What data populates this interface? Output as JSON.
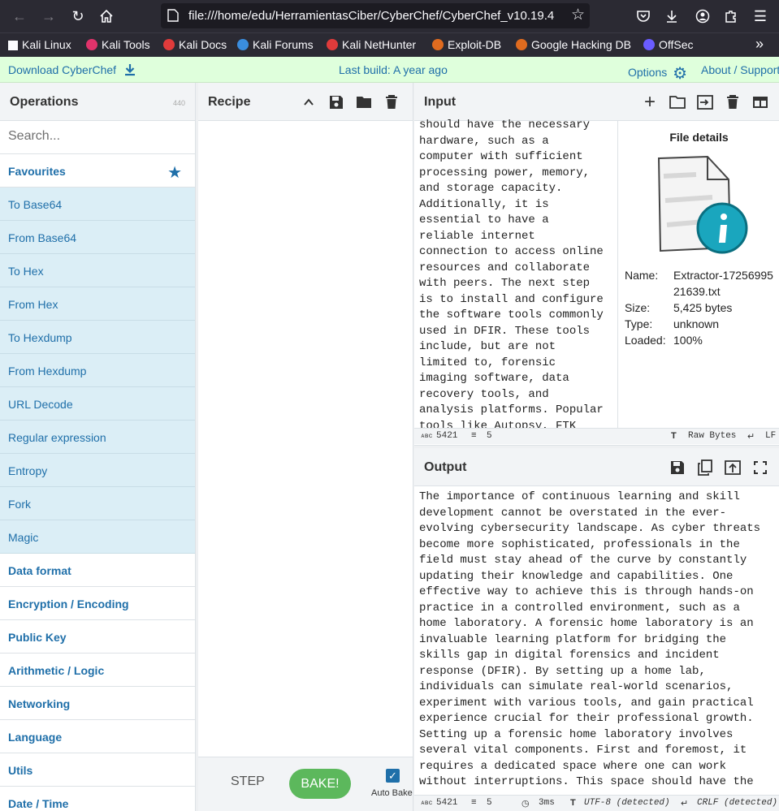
{
  "browser": {
    "url": "file:///home/edu/HerramientasCiber/CyberChef/CyberChef_v10.19.4",
    "bookmarks": [
      {
        "label": "Kali Linux",
        "color": "#3a8dde"
      },
      {
        "label": "Kali Tools",
        "color": "#e0336b"
      },
      {
        "label": "Kali Docs",
        "color": "#e03b3b"
      },
      {
        "label": "Kali Forums",
        "color": "#3a8dde"
      },
      {
        "label": "Kali NetHunter",
        "color": "#e03b3b"
      },
      {
        "label": "Exploit-DB",
        "color": "#e06b1f"
      },
      {
        "label": "Google Hacking DB",
        "color": "#e06b1f"
      },
      {
        "label": "OffSec",
        "color": "#6a5cff"
      }
    ]
  },
  "banner": {
    "download": "Download CyberChef",
    "last_build": "Last build: A year ago",
    "options": "Options",
    "about": "About / Support"
  },
  "operations": {
    "title": "Operations",
    "count": "440",
    "search_placeholder": "Search...",
    "favourites_label": "Favourites",
    "favourites": [
      "To Base64",
      "From Base64",
      "To Hex",
      "From Hex",
      "To Hexdump",
      "From Hexdump",
      "URL Decode",
      "Regular expression",
      "Entropy",
      "Fork",
      "Magic"
    ],
    "categories": [
      "Data format",
      "Encryption / Encoding",
      "Public Key",
      "Arithmetic / Logic",
      "Networking",
      "Language",
      "Utils",
      "Date / Time"
    ]
  },
  "recipe": {
    "title": "Recipe",
    "step": "STEP",
    "bake": "BAKE!",
    "auto_bake": "Auto Bake"
  },
  "input": {
    "title": "Input",
    "text": "should have the necessary\nhardware, such as a\ncomputer with sufficient\nprocessing power, memory,\nand storage capacity.\nAdditionally, it is\nessential to have a\nreliable internet\nconnection to access online\nresources and collaborate\nwith peers. The next step\nis to install and configure\nthe software tools commonly\nused in DFIR. These tools\ninclude, but are not\nlimited to, forensic\nimaging software, data\nrecovery tools, and\nanalysis platforms. Popular\ntools like Autopsy, FTK",
    "file_details": {
      "title": "File details",
      "name_label": "Name:",
      "name_line1": "Extractor-17256995",
      "name_line2": "21639.txt",
      "size_label": "Size:",
      "size": "5,425 bytes",
      "type_label": "Type:",
      "type": "unknown",
      "loaded_label": "Loaded:",
      "loaded": "100%"
    },
    "status": {
      "abc": "ᴀʙᴄ",
      "length": "5421",
      "lines": "5",
      "encoding": "Raw Bytes",
      "eol": "LF"
    }
  },
  "output": {
    "title": "Output",
    "text": "The importance of continuous learning and skill\ndevelopment cannot be overstated in the ever-\nevolving cybersecurity landscape. As cyber threats\nbecome more sophisticated, professionals in the\nfield must stay ahead of the curve by constantly\nupdating their knowledge and capabilities. One\neffective way to achieve this is through hands-on\npractice in a controlled environment, such as a\nhome laboratory. A forensic home laboratory is an\ninvaluable learning platform for bridging the\nskills gap in digital forensics and incident\nresponse (DFIR). By setting up a home lab,\nindividuals can simulate real-world scenarios,\nexperiment with various tools, and gain practical\nexperience crucial for their professional growth.\nSetting up a forensic home laboratory involves\nseveral vital components. First and foremost, it\nrequires a dedicated space where one can work\nwithout interruptions. This space should have the",
    "status": {
      "abc": "ᴀʙᴄ",
      "length": "5421",
      "lines": "5",
      "time": "3ms",
      "encoding": "UTF-8 (detected)",
      "eol": "CRLF (detected)"
    }
  }
}
